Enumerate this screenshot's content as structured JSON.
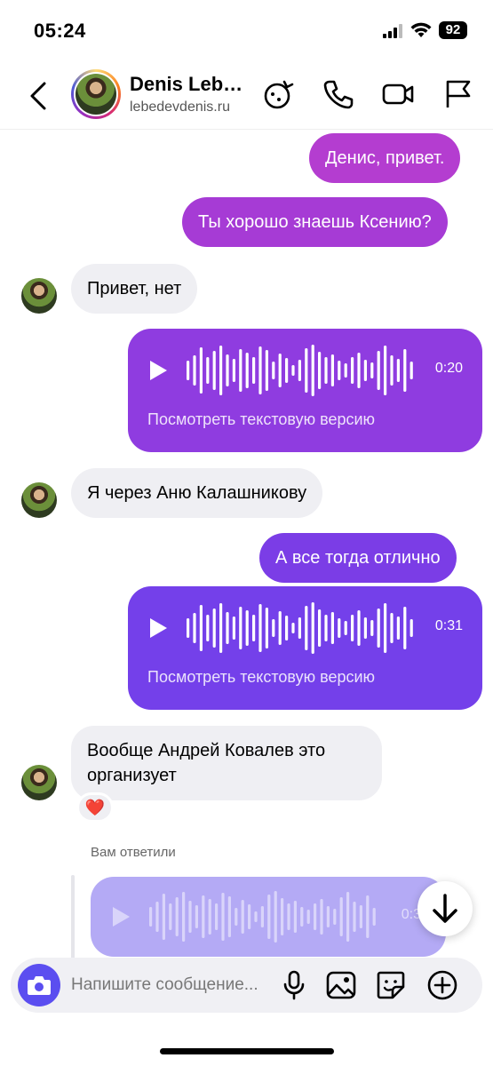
{
  "status_bar": {
    "time": "05:24",
    "battery": "92"
  },
  "header": {
    "contact_name": "Denis Leb…",
    "contact_subtitle": "lebedevdenis.ru"
  },
  "messages": [
    {
      "side": "out",
      "text": "Денис, привет."
    },
    {
      "side": "out",
      "text": "Ты хорошо знаешь Ксению?"
    },
    {
      "side": "in",
      "text": "Привет, нет"
    },
    {
      "side": "out",
      "type": "voice",
      "duration": "0:20",
      "transcript_link": "Посмотреть текстовую версию"
    },
    {
      "side": "in",
      "text": "Я через Аню Калашникову"
    },
    {
      "side": "out",
      "text": "А все тогда отлично"
    },
    {
      "side": "out",
      "type": "voice",
      "duration": "0:31",
      "transcript_link": "Посмотреть текстовую версию"
    },
    {
      "side": "in",
      "text": "Вообще Андрей Ковалев это организует",
      "reaction": "❤️"
    },
    {
      "side": "out",
      "type": "voice-reply",
      "label": "Вам ответили",
      "duration": "0:3"
    }
  ],
  "composer": {
    "placeholder": "Напишите сообщение..."
  },
  "colors": {
    "outgoing_start": "#b43dd0",
    "outgoing_end": "#6c3cf0",
    "incoming": "#efeff3",
    "camera": "#5b4ef0"
  }
}
